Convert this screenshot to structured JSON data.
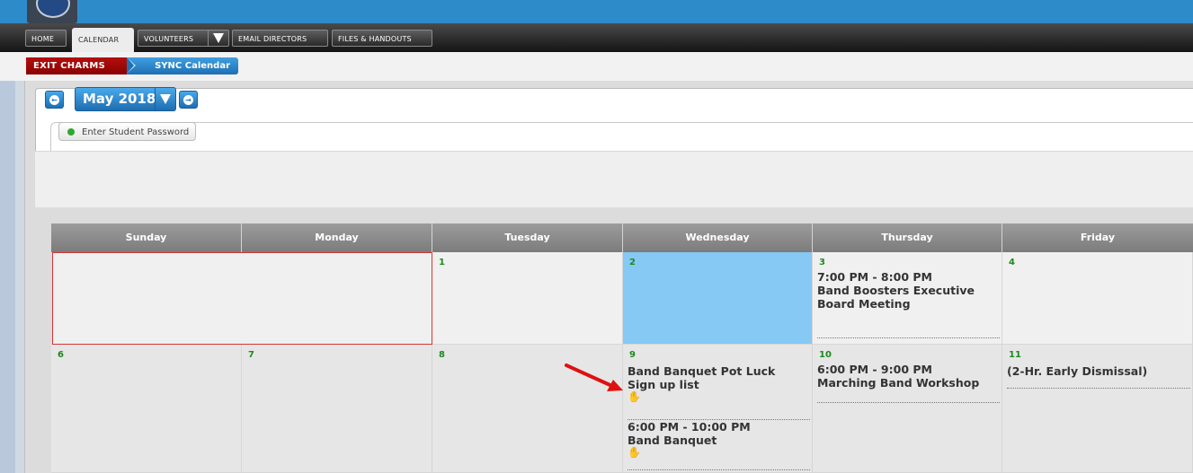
{
  "nav": {
    "tabs": [
      {
        "label": "HOME"
      },
      {
        "label": "CALENDAR"
      },
      {
        "label": "VOLUNTEERS"
      },
      {
        "label": "EMAIL DIRECTORS"
      },
      {
        "label": "FILES & HANDOUTS"
      }
    ]
  },
  "toolbar": {
    "exit_label": "EXIT CHARMS",
    "sync_label": "SYNC Calendar"
  },
  "calendar_header": {
    "month_label": "May 2018",
    "password_button": "Enter Student Password"
  },
  "calendar": {
    "weekdays": [
      "Sunday",
      "Monday",
      "Tuesday",
      "Wednesday",
      "Thursday",
      "Friday"
    ],
    "week1": {
      "tue": {
        "day": "1"
      },
      "wed": {
        "day": "2"
      },
      "thu": {
        "day": "3",
        "event_time": "7:00 PM - 8:00 PM",
        "event_title": "Band Boosters Executive Board Meeting"
      },
      "fri": {
        "day": "4"
      }
    },
    "week2": {
      "sun": {
        "day": "6"
      },
      "mon": {
        "day": "7"
      },
      "tue": {
        "day": "8"
      },
      "wed": {
        "day": "9",
        "event1_title": "Band Banquet Pot Luck Sign up list",
        "event2_time": "6:00 PM - 10:00 PM",
        "event2_title": "Band Banquet"
      },
      "thu": {
        "day": "10",
        "event_time": "6:00 PM - 9:00 PM",
        "event_title": "Marching Band Workshop"
      },
      "fri": {
        "day": "11",
        "event_title": "(2-Hr. Early Dismissal)"
      }
    }
  },
  "colors": {
    "accent_blue": "#2e8bc9",
    "exit_red": "#a00808",
    "today_blue": "#86c9f5",
    "day_number_green": "#1d8a1d",
    "annotation_red": "#e01010"
  },
  "icons": {
    "volunteer_hand": "hand-icon",
    "prev": "arrow-left-icon",
    "next": "arrow-right-icon",
    "dropdown": "chevron-down-icon"
  }
}
